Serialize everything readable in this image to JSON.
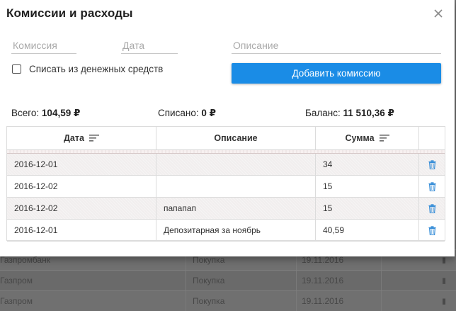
{
  "background": {
    "rows": [
      {
        "name": "Газпромбанк",
        "type": "Покупка",
        "date": "19.11.2016"
      },
      {
        "name": "Газпром",
        "type": "Покупка",
        "date": "19.11.2016"
      },
      {
        "name": "Газпром",
        "type": "Покупка",
        "date": "19.11.2016"
      }
    ]
  },
  "modal": {
    "title": "Комиссии и расходы",
    "close_icon": "close-icon",
    "form": {
      "commission_placeholder": "Комиссия",
      "commission_value": "",
      "date_placeholder": "Дата",
      "date_value": "",
      "description_placeholder": "Описание",
      "description_value": "",
      "write_off_label": "Списать из денежных средств",
      "write_off_checked": false,
      "add_button_label": "Добавить комиссию"
    },
    "summary": {
      "total_label": "Всего:",
      "total_value": "104,59 ₽",
      "written_label": "Списано:",
      "written_value": "0 ₽",
      "balance_label": "Баланс:",
      "balance_value": "11 510,36 ₽"
    },
    "table": {
      "headers": {
        "date": "Дата",
        "description": "Описание",
        "sum": "Сумма"
      },
      "rows": [
        {
          "date": "2016-12-01",
          "description": "",
          "sum": "34"
        },
        {
          "date": "2016-12-02",
          "description": "",
          "sum": "15"
        },
        {
          "date": "2016-12-02",
          "description": "папапап",
          "sum": "15"
        },
        {
          "date": "2016-12-01",
          "description": "Депозитарная за ноябрь",
          "sum": "40,59"
        }
      ]
    }
  },
  "colors": {
    "primary_button": "#1a8ce6",
    "trash_icon": "#3a8fd8",
    "overlay": "#6e6e6e"
  }
}
